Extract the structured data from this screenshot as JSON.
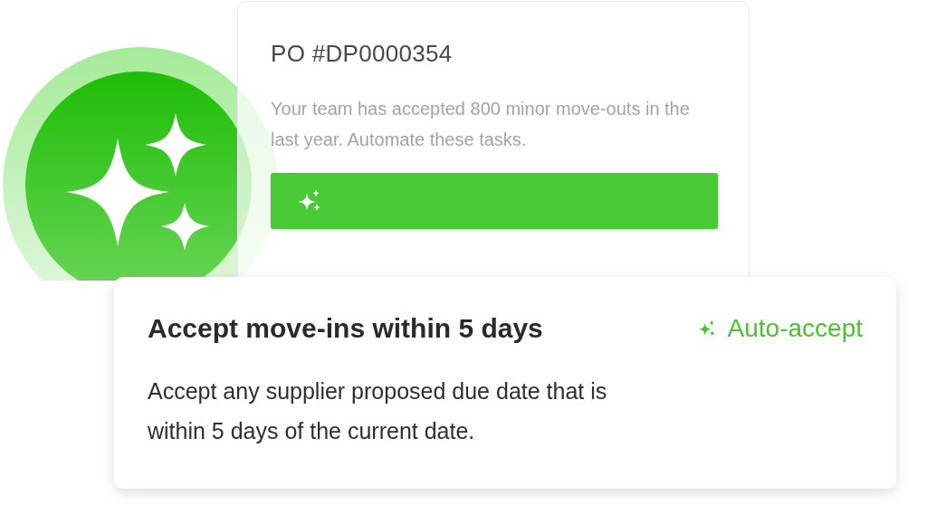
{
  "po_card": {
    "title": "PO #DP0000354",
    "description": "Your team has accepted 800 minor move-outs in the last year. Automate these tasks."
  },
  "rule_card": {
    "title": "Accept move-ins within 5 days",
    "action": {
      "label": "Auto-accept"
    },
    "description": "Accept any supplier proposed due date that is within 5 days of the current date."
  }
}
